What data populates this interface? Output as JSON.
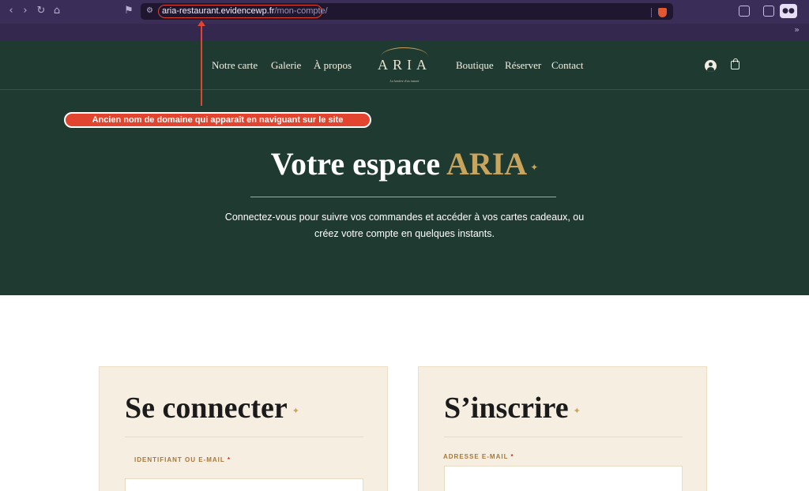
{
  "browser": {
    "url_domain": "aria-restaurant.evidencewp.fr",
    "url_path": "/mon-compte/",
    "overflow_label": "»"
  },
  "annotation": {
    "text": "Ancien nom de domaine qui apparaît en naviguant sur le site"
  },
  "site": {
    "nav_left": [
      "Notre carte",
      "Galerie",
      "À propos"
    ],
    "logo_text": "ARIA",
    "logo_tagline": "La lumière d'un instant",
    "nav_right": [
      "Boutique",
      "Réserver",
      "Contact"
    ]
  },
  "hero": {
    "title_prefix": "Votre espace",
    "title_accent": "ARIA",
    "subtitle_line1": "Connectez-vous pour suivre vos commandes et accéder à vos cartes cadeaux, ou",
    "subtitle_line2": "créez votre compte en quelques instants."
  },
  "login": {
    "title": "Se connecter",
    "field_label": "IDENTIFIANT OU E-MAIL",
    "required_mark": "*"
  },
  "register": {
    "title": "S’inscrire",
    "field_label": "ADRESSE E-MAIL",
    "required_mark": "*"
  },
  "colors": {
    "brand_green": "#1f3a31",
    "gold": "#c9a45c",
    "annotation_red": "#e2452f",
    "card_bg": "#f6efe1"
  }
}
